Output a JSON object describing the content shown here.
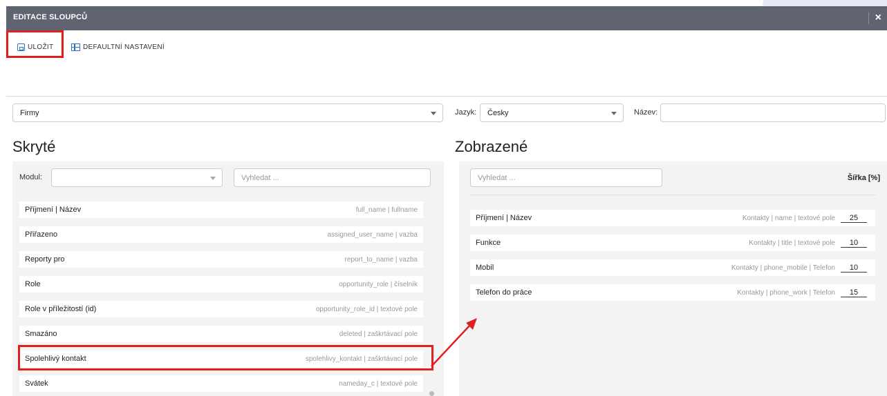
{
  "dialog": {
    "title": "EDITACE SLOUPCŮ",
    "close_icon": "×"
  },
  "toolbar": {
    "save_label": "ULOŽIT",
    "default_label": "DEFAULTNÍ NASTAVENÍ"
  },
  "filters": {
    "module_value": "Firmy",
    "language_label": "Jazyk:",
    "language_value": "Česky",
    "name_label": "Název:",
    "name_value": ""
  },
  "hidden": {
    "heading": "Skryté",
    "module_label": "Modul:",
    "module_value": "",
    "search_placeholder": "Vyhledat ...",
    "items": [
      {
        "name": "Příjmení | Název",
        "meta": "full_name | fullname"
      },
      {
        "name": "Přiřazeno",
        "meta": "assigned_user_name | vazba"
      },
      {
        "name": "Reporty pro",
        "meta": "report_to_name | vazba"
      },
      {
        "name": "Role",
        "meta": "opportunity_role | číselník"
      },
      {
        "name": "Role v příležitostí (id)",
        "meta": "opportunity_role_id | textové pole"
      },
      {
        "name": "Smazáno",
        "meta": "deleted | zaškrtávací pole"
      },
      {
        "name": "Spolehlivý kontakt",
        "meta": "spolehlivy_kontakt | zaškrtávací pole"
      },
      {
        "name": "Svátek",
        "meta": "nameday_c | textové pole"
      }
    ]
  },
  "shown": {
    "heading": "Zobrazené",
    "search_placeholder": "Vyhledat ...",
    "width_header": "Šířka [%]",
    "items": [
      {
        "name": "Příjmení | Název",
        "meta": "Kontakty | name | textové pole",
        "width": "25"
      },
      {
        "name": "Funkce",
        "meta": "Kontakty | title | textové pole",
        "width": "10"
      },
      {
        "name": "Mobil",
        "meta": "Kontakty | phone_mobile | Telefon",
        "width": "10"
      },
      {
        "name": "Telefon do práce",
        "meta": "Kontakty | phone_work | Telefon",
        "width": "15"
      }
    ]
  },
  "colors": {
    "accent": "#2a6fc9",
    "highlight": "#e02020",
    "titlebar": "#5f6470"
  }
}
